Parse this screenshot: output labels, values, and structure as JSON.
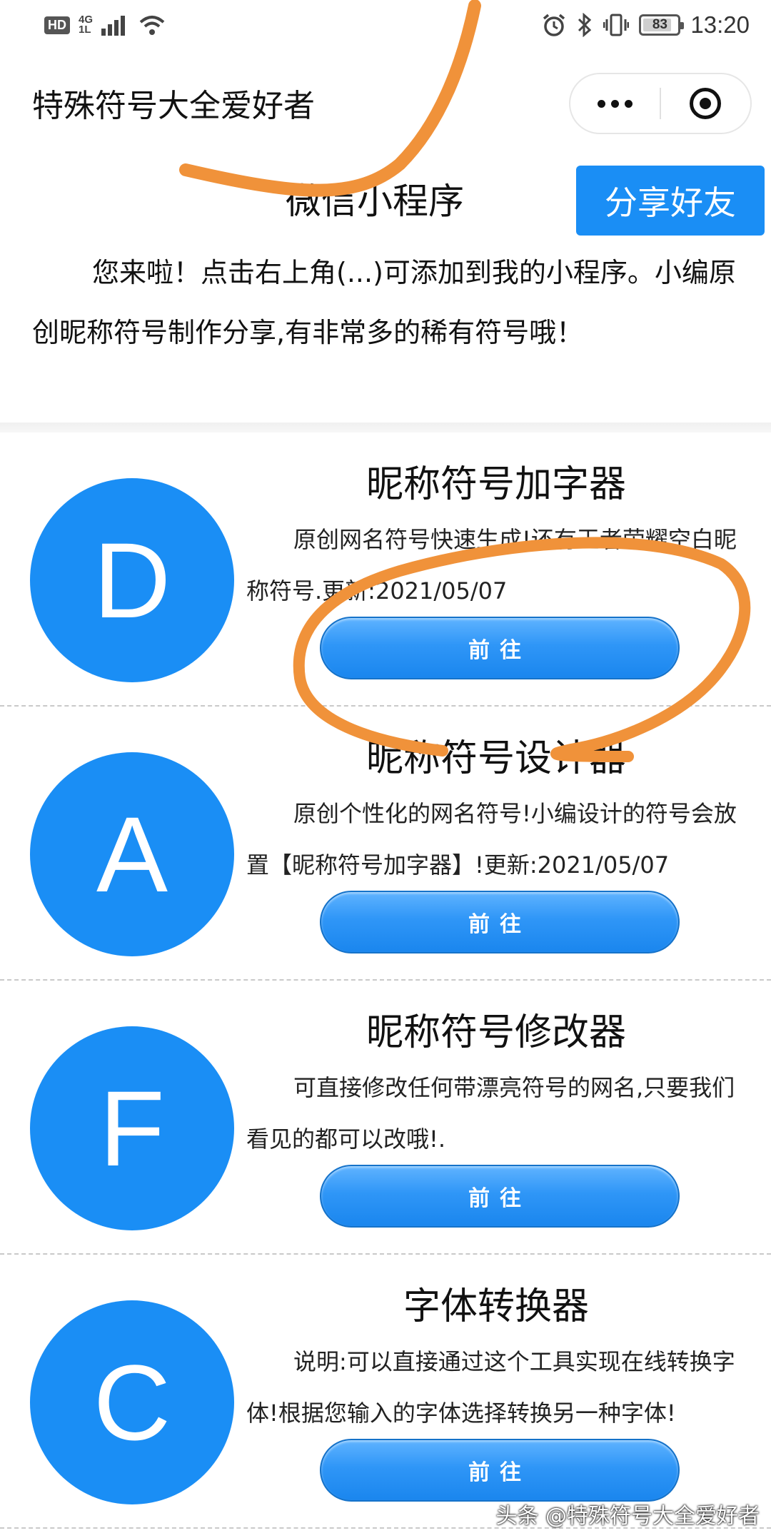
{
  "status_bar": {
    "hd": "HD",
    "network_top": "4G",
    "network_bottom": "1L",
    "battery": "83",
    "battery_level": 0.83,
    "time": "13:20",
    "icons": [
      "signal-icon",
      "wifi-icon",
      "alarm-icon",
      "bluetooth-icon",
      "vibrate-icon"
    ]
  },
  "header": {
    "title": "特殊符号大全爱好者",
    "more_icon": "more-dots-icon",
    "close_icon": "target-close-icon"
  },
  "intro": {
    "title": "微信小程序",
    "share_button": "分享好友",
    "text": "您来啦！点击右上角(...)可添加到我的小程序。小编原创昵称符号制作分享,有非常多的稀有符号哦！"
  },
  "tools": [
    {
      "letter": "D",
      "title": "昵称符号加字器",
      "desc": "原创网名符号快速生成!还有王者荣耀空白昵称符号.更新:2021/05/07",
      "button": "前往"
    },
    {
      "letter": "A",
      "title": "昵称符号设计器",
      "desc": "原创个性化的网名符号!小编设计的符号会放置【昵称符号加字器】!更新:2021/05/07",
      "button": "前往"
    },
    {
      "letter": "F",
      "title": "昵称符号修改器",
      "desc": "可直接修改任何带漂亮符号的网名,只要我们看见的都可以改哦!.",
      "button": "前往"
    },
    {
      "letter": "C",
      "title": "字体转换器",
      "desc": "说明:可以直接通过这个工具实现在线转换字体!根据您输入的字体选择转换另一种字体!",
      "button": "前往"
    }
  ],
  "watermark": "头条 @特殊符号大全爱好者",
  "colors": {
    "accent": "#1a8ef5",
    "annotation": "#f0923a"
  }
}
